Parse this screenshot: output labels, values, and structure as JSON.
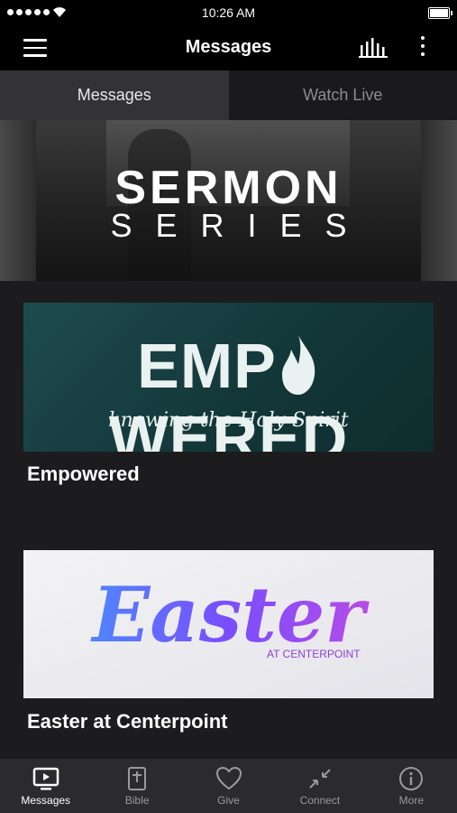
{
  "status_bar": {
    "time": "10:26 AM"
  },
  "navbar": {
    "title": "Messages"
  },
  "tabs": [
    {
      "label": "Messages",
      "active": true
    },
    {
      "label": "Watch Live",
      "active": false
    }
  ],
  "hero": {
    "line1": "SERMON",
    "line2": "SERIES"
  },
  "cards": [
    {
      "title": "Empowered",
      "art_word_left": "EMP",
      "art_word_right": "WERED",
      "art_sub": "knowing the Holy Spirit"
    },
    {
      "title": "Easter at Centerpoint",
      "art_word": "Easter",
      "art_sub": "AT CENTERPOINT"
    }
  ],
  "tabbar": [
    {
      "label": "Messages",
      "icon": "tv-icon",
      "active": true
    },
    {
      "label": "Bible",
      "icon": "bible-icon",
      "active": false
    },
    {
      "label": "Give",
      "icon": "heart-icon",
      "active": false
    },
    {
      "label": "Connect",
      "icon": "connect-icon",
      "active": false
    },
    {
      "label": "More",
      "icon": "info-icon",
      "active": false
    }
  ]
}
